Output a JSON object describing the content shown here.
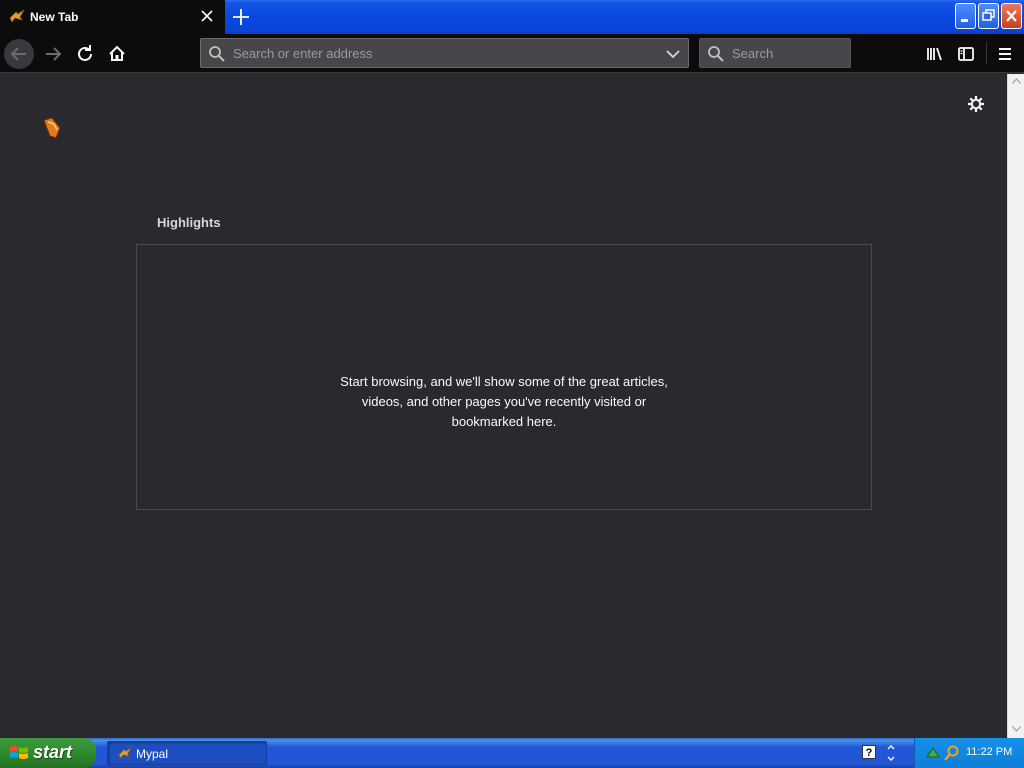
{
  "tab": {
    "title": "New Tab"
  },
  "urlbar": {
    "placeholder": "Search or enter address"
  },
  "searchbar": {
    "placeholder": "Search"
  },
  "highlights": {
    "title": "Highlights",
    "empty_message": "Start browsing, and we'll show some of the great articles, videos, and other pages you've recently visited or bookmarked here."
  },
  "taskbar": {
    "start_label": "start",
    "app_label": "Mypal",
    "clock": "11:22 PM"
  },
  "colors": {
    "chrome": "#0c0c0d",
    "page_bg": "#2a2a2e",
    "xp_blue": "#2157d7",
    "start_green": "#2f8b2f"
  }
}
